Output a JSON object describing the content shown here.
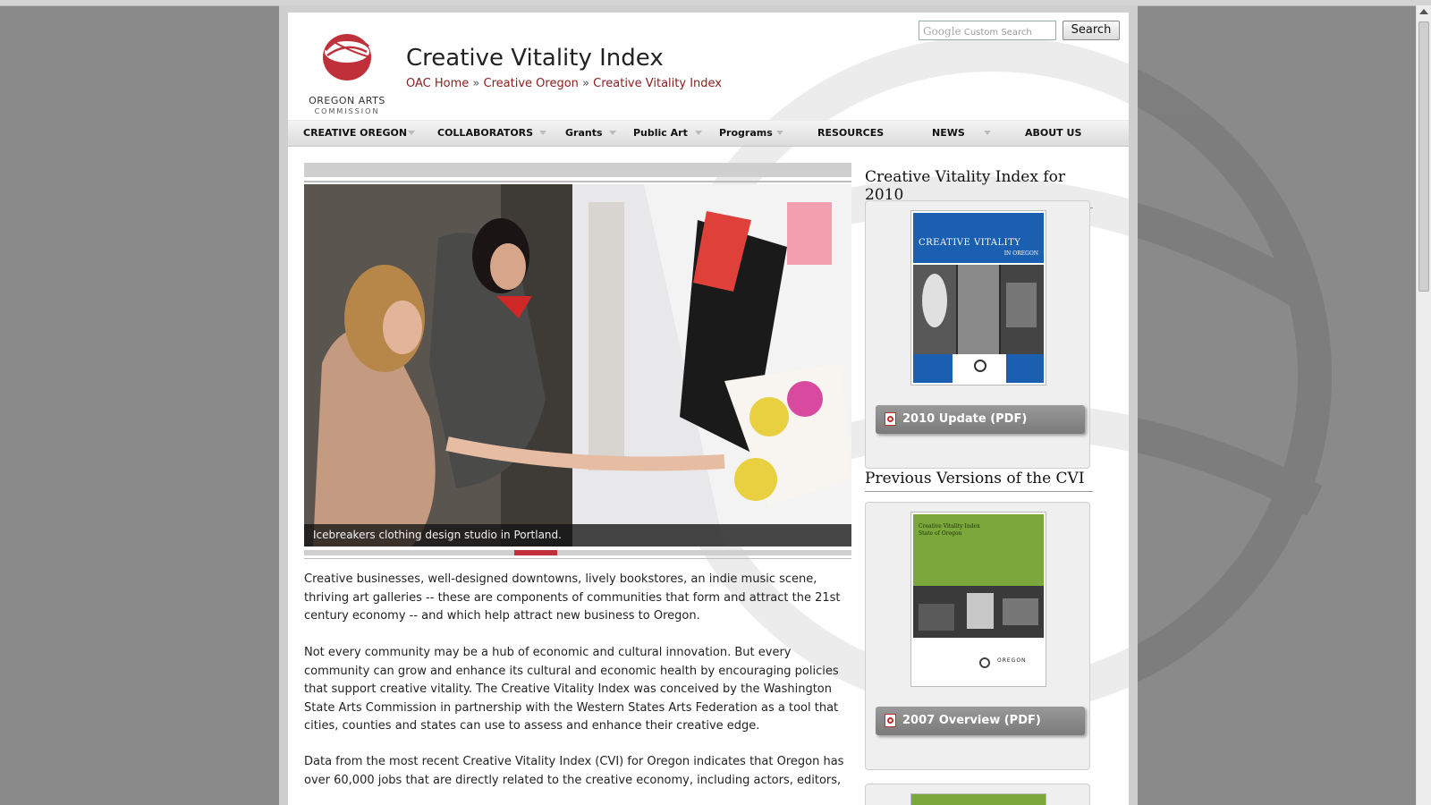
{
  "header": {
    "logo_line1": "OREGON ARTS",
    "logo_line2": "COMMISSION",
    "title": "Creative Vitality Index",
    "breadcrumb": [
      "OAC Home",
      "Creative Oregon",
      "Creative Vitality Index"
    ],
    "breadcrumb_sep": "»"
  },
  "search": {
    "google_label": "Google",
    "placeholder": "Custom Search",
    "button_label": "Search"
  },
  "nav": [
    {
      "label": "CREATIVE OREGON",
      "has_menu": true
    },
    {
      "label": "COLLABORATORS",
      "has_menu": true
    },
    {
      "label": "Grants",
      "has_menu": true
    },
    {
      "label": "Public Art",
      "has_menu": true
    },
    {
      "label": "Programs",
      "has_menu": true
    },
    {
      "label": "RESOURCES",
      "has_menu": false
    },
    {
      "label": "NEWS",
      "has_menu": true
    },
    {
      "label": "ABOUT US",
      "has_menu": false
    }
  ],
  "slideshow": {
    "caption": "Icebreakers clothing design studio in Portland."
  },
  "body": {
    "p1": "Creative businesses, well-designed downtowns, lively bookstores, an indie music scene, thriving art galleries -- these are components of communities that form and attract the 21st century economy -- and which help attract new business to Oregon.",
    "p2": "Not every community may be a hub of economic and cultural innovation. But every community can grow and enhance its cultural and economic health by encouraging policies that support creative vitality. The Creative Vitality Index was conceived by the Washington State Arts Commission in partnership with the Western States Arts Federation as a tool that cities, counties and states can use to assess and enhance their creative edge.",
    "p3": "Data from the most recent Creative Vitality Index (CVI) for Oregon indicates that Oregon has over 60,000 jobs that are directly related to the creative economy, including actors, editors,"
  },
  "sidebar": {
    "heading1": "Creative Vitality Index for 2010",
    "cover1_title": "CREATIVE VITALITY",
    "cover1_subtitle": "IN OREGON",
    "button1": "2010 Update (PDF)",
    "heading2": "Previous Versions of the CVI",
    "cover2_title": "Creative Vitality Index",
    "cover2_subtitle": "State of Oregon",
    "cover2_footer": "OREGON",
    "button2": "2007 Overview (PDF)"
  },
  "colors": {
    "brand_red": "#c0303a",
    "link_red": "#8a1c1c",
    "cover1_blue": "#1a5fb0",
    "cover2_green": "#7aa83a"
  },
  "icons": [
    "pdf-icon",
    "oac-logo-icon",
    "scroll-up-icon"
  ]
}
